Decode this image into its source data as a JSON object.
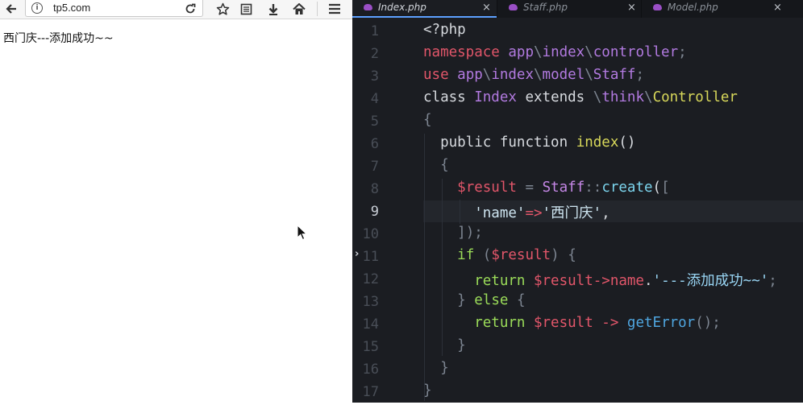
{
  "browser": {
    "url": "tp5.com",
    "icons": {
      "back": "arrow-left-icon",
      "info": "info-icon",
      "reload": "reload-icon",
      "bookmark": "star-icon",
      "reader": "reader-view-icon",
      "download": "download-icon",
      "home": "home-icon",
      "menu": "hamburger-menu-icon"
    },
    "page_text": "西门庆---添加成功~~"
  },
  "editor": {
    "tabs": [
      {
        "label": "Index.php",
        "active": true,
        "close": "×"
      },
      {
        "label": "Staff.php",
        "active": false,
        "close": "×"
      },
      {
        "label": "Model.php",
        "active": false,
        "close": "×"
      }
    ],
    "current_line": 9,
    "line_numbers": [
      "1",
      "2",
      "3",
      "4",
      "5",
      "6",
      "7",
      "8",
      "9",
      "10",
      "11",
      "12",
      "13",
      "14",
      "15",
      "16",
      "17"
    ],
    "code": {
      "l1": {
        "a": "<?php"
      },
      "l2": {
        "kw": "namespace",
        "ns1": "app",
        "s1": "\\",
        "ns2": "index",
        "s2": "\\",
        "ns3": "controller",
        "end": ";"
      },
      "l3": {
        "kw": "use",
        "ns1": "app",
        "s1": "\\",
        "ns2": "index",
        "s2": "\\",
        "ns3": "model",
        "s3": "\\",
        "ns4": "Staff",
        "end": ";"
      },
      "l4": {
        "kw": "class",
        "name": "Index",
        "ext": "extends",
        "s1": "\\",
        "ns1": "think",
        "s2": "\\",
        "parent": "Controller"
      },
      "l5": {
        "b": "{"
      },
      "l6": {
        "kw1": "public",
        "kw2": "function",
        "name": "index",
        "parens": "()"
      },
      "l7": {
        "b": "{"
      },
      "l8": {
        "var": "$result",
        "eq": "=",
        "cls": "Staff",
        "dc": "::",
        "fn": "create",
        "p": "(",
        "br": "["
      },
      "l9": {
        "key": "'name'",
        "arrow": "=>",
        "val": "'西门庆'",
        "comma": ","
      },
      "l10": {
        "close": "]);"
      },
      "l11": {
        "kw": "if",
        "p1": "(",
        "var": "$result",
        "p2": ")",
        "b": "{"
      },
      "l12": {
        "kw": "return",
        "var": "$result",
        "arrow": "->",
        "prop": "name",
        "dot": ".",
        "str": "'---添加成功~~'",
        "end": ";"
      },
      "l13": {
        "b1": "}",
        "kw": "else",
        "b2": "{"
      },
      "l14": {
        "kw": "return",
        "var": "$result",
        "arrow": "->",
        "fn": "getError",
        "parens": "()",
        "end": ";"
      },
      "l15": {
        "b": "}"
      },
      "l16": {
        "b": "}"
      },
      "l17": {
        "b": "}"
      }
    }
  }
}
